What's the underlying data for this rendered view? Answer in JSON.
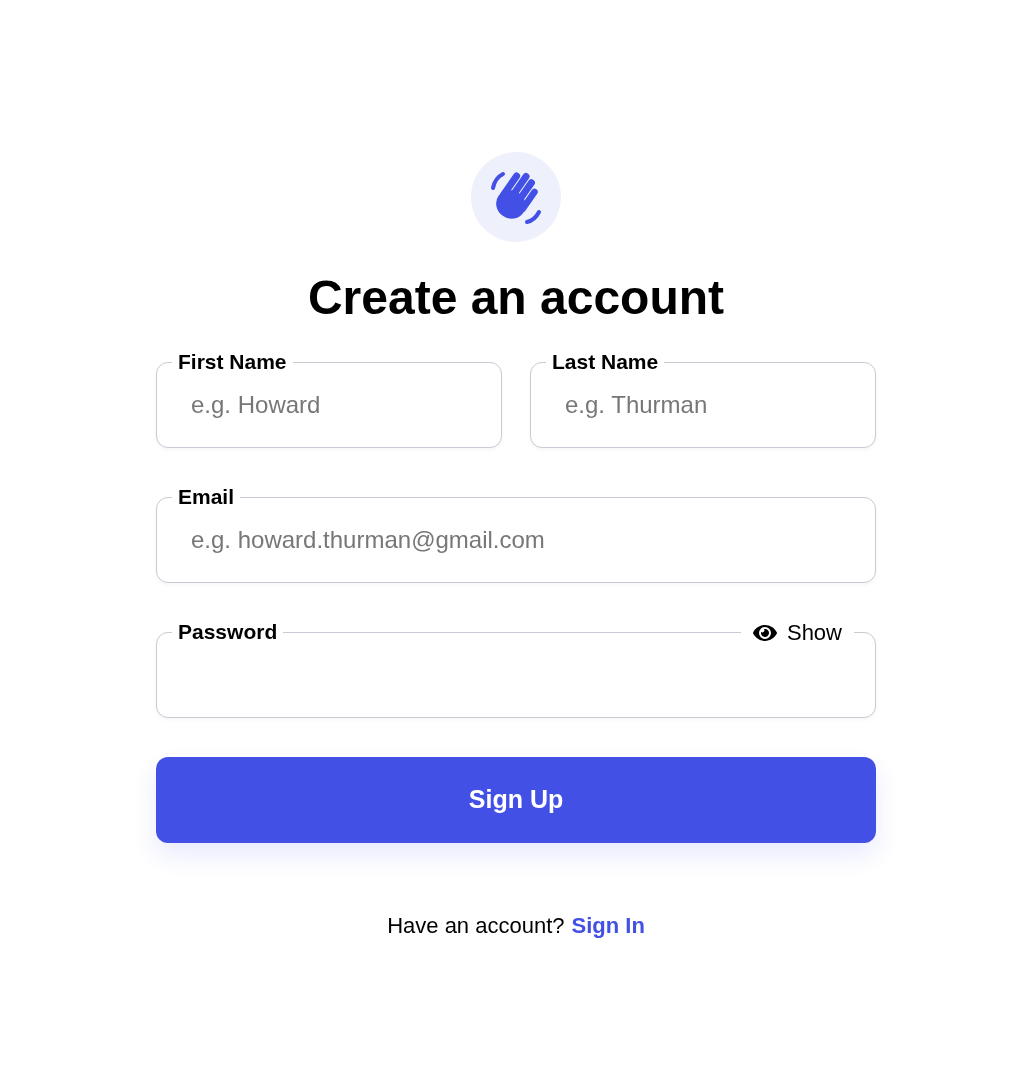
{
  "title": "Create an account",
  "rows": [
    [
      {
        "label": "First Name",
        "placeholder": "e.g. Howard"
      },
      {
        "label": "Last Name",
        "placeholder": "e.g. Thurman"
      }
    ],
    [
      {
        "label": "Email",
        "placeholder": "e.g. howard.thurman@gmail.com"
      }
    ],
    [
      {
        "label": "Password",
        "toggle": "Show"
      }
    ]
  ],
  "submit": "Sign Up",
  "footer": {
    "text": "Have an account?",
    "link": "Sign In"
  }
}
